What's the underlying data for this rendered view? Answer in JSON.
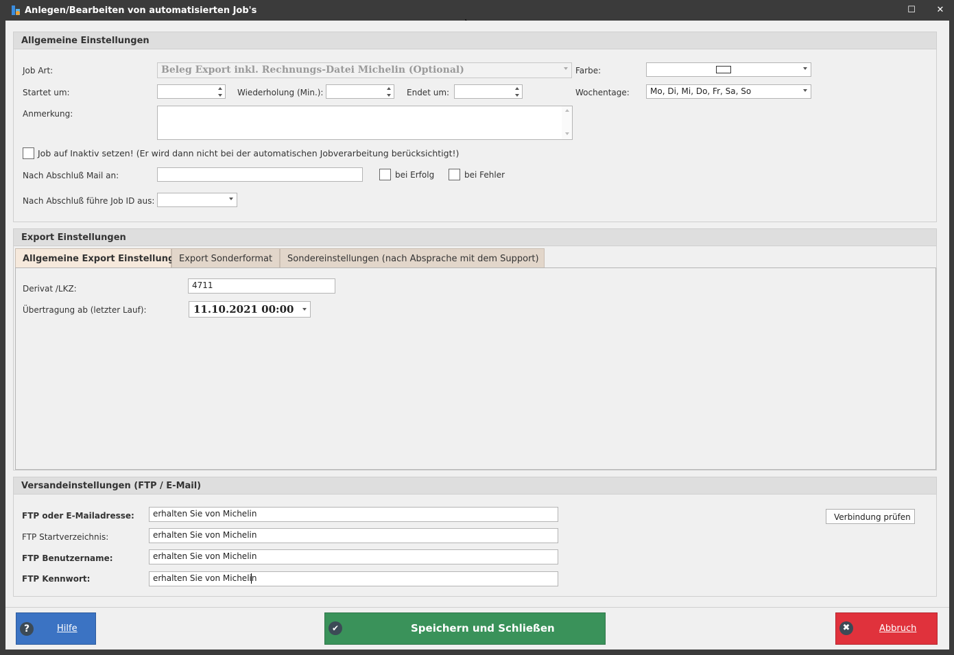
{
  "window": {
    "title": "Anlegen/Bearbeiten von automatisierten Job's",
    "maximize_glyph": "☐",
    "close_glyph": "✕"
  },
  "allgemein": {
    "header": "Allgemeine Einstellungen",
    "job_art_label": "Job Art:",
    "job_art_value": "Beleg Export inkl. Rechnungs-Datei Michelin (Optional)",
    "farbe_label": "Farbe:",
    "startet_label": "Startet um:",
    "startet_value": "",
    "wiederholung_label": "Wiederholung (Min.):",
    "wiederholung_value": "",
    "endet_label": "Endet um:",
    "endet_value": "",
    "wochentage_label": "Wochentage:",
    "wochentage_value": "Mo, Di, Mi, Do, Fr, Sa, So",
    "anmerkung_label": "Anmerkung:",
    "anmerkung_value": "",
    "inaktiv_label": "Job auf Inaktiv setzen! (Er wird dann nicht bei der automatischen Jobverarbeitung berücksichtigt!)",
    "inaktiv_checked": false,
    "mail_label": "Nach Abschluß Mail an:",
    "mail_value": "",
    "bei_erfolg_label": "bei Erfolg",
    "bei_erfolg_checked": false,
    "bei_fehler_label": "bei Fehler",
    "bei_fehler_checked": false,
    "job_id_label": "Nach Abschluß führe Job ID aus:",
    "job_id_value": ""
  },
  "export": {
    "header": "Export Einstellungen",
    "tabs": [
      {
        "label": "Allgemeine Export Einstellungen",
        "active": true
      },
      {
        "label": "Export Sonderformat",
        "active": false
      },
      {
        "label": "Sondereinstellungen (nach Absprache mit dem Support)",
        "active": false
      }
    ],
    "derivat_label": "Derivat /LKZ:",
    "derivat_value": "4711",
    "uebertragung_label": "Übertragung ab (letzter Lauf):",
    "uebertragung_value": "11.10.2021 00:00"
  },
  "versand": {
    "header": "Versandeinstellungen (FTP / E-Mail)",
    "ftp_mail_label": "FTP oder E-Mailadresse:",
    "ftp_mail_value": "erhalten Sie von Michelin",
    "start_dir_label": "FTP Startverzeichnis:",
    "start_dir_value": "erhalten Sie von Michelin",
    "user_label": "FTP Benutzername:",
    "user_value": "erhalten Sie von Michelin",
    "password_label": "FTP Kennwort:",
    "password_value": "erhalten Sie von Michelin",
    "verbindung_label": "Verbindung prüfen"
  },
  "footer": {
    "hilfe_label": "Hilfe",
    "hilfe_icon": "?",
    "speichern_label": "Speichern und Schließen",
    "speichern_icon": "✔",
    "abbruch_label": "Abbruch",
    "abbruch_icon": "✖"
  },
  "colors": {
    "hilfe_bg": "#3b73c3",
    "speichern_bg": "#3a925a",
    "abbruch_bg": "#e0323c",
    "titlebar_bg": "#3b3b3b"
  }
}
